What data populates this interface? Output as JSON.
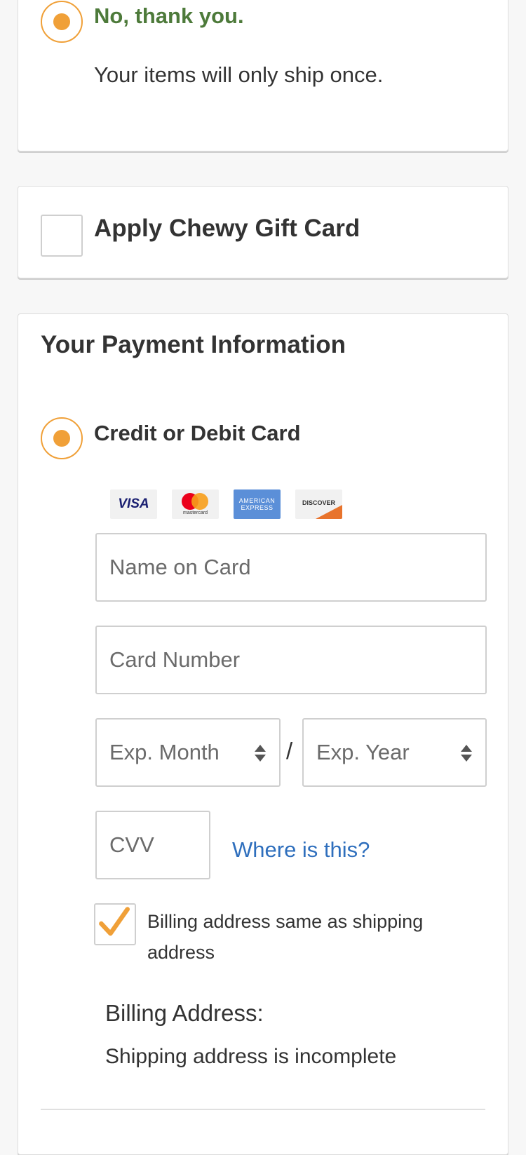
{
  "ship_option": {
    "title": "No, thank you.",
    "description": "Your items will only ship once."
  },
  "gift_card": {
    "label": "Apply Chewy Gift Card"
  },
  "payment": {
    "heading": "Your Payment Information",
    "method_label": "Credit or Debit Card",
    "card_logos": [
      "VISA",
      "mastercard",
      "AMERICAN EXPRESS",
      "DISCOVER"
    ],
    "name_placeholder": "Name on Card",
    "number_placeholder": "Card Number",
    "exp_month_placeholder": "Exp. Month",
    "exp_separator": "/",
    "exp_year_placeholder": "Exp. Year",
    "cvv_placeholder": "CVV",
    "cvv_help_link": "Where is this?",
    "billing_same_label": "Billing address same as shipping address",
    "billing_heading": "Billing Address:",
    "billing_status": "Shipping address is incomplete"
  },
  "colors": {
    "accent_orange": "#f0a038",
    "green_title": "#4d7a3a",
    "link_blue": "#2f6fbd"
  },
  "icons": [
    "radio-selected-icon",
    "checkbox-empty-icon",
    "checkmark-icon",
    "select-arrows-icon"
  ]
}
